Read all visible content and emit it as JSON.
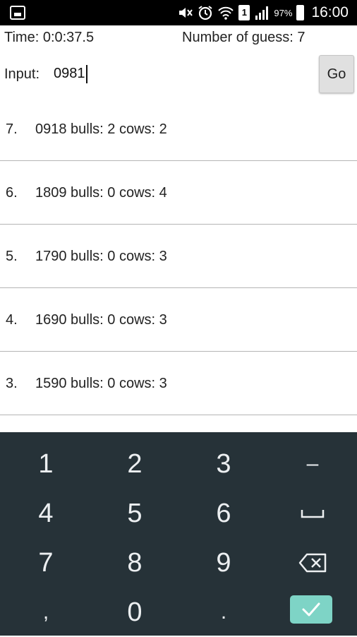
{
  "status_bar": {
    "battery": "97%",
    "sim": "1",
    "time": "16:00",
    "icons": [
      "screenshot-icon",
      "mute-icon",
      "alarm-icon",
      "wifi-icon",
      "sim-icon",
      "signal-icon",
      "battery-icon"
    ]
  },
  "header": {
    "time_label": "Time: 0:0:37.5",
    "guess_count_label": "Number of guess: 7"
  },
  "input": {
    "label": "Input:",
    "value": "0981",
    "go_label": "Go"
  },
  "guesses": [
    {
      "num": "7.",
      "text": "0918 bulls: 2 cows: 2"
    },
    {
      "num": "6.",
      "text": "1809 bulls: 0 cows: 4"
    },
    {
      "num": "5.",
      "text": "1790 bulls: 0 cows: 3"
    },
    {
      "num": "4.",
      "text": "1690 bulls: 0 cows: 3"
    },
    {
      "num": "3.",
      "text": "1590 bulls: 0 cows: 3"
    }
  ],
  "keyboard": {
    "keys": [
      "1",
      "2",
      "3",
      "–",
      "4",
      "5",
      "6",
      "␣",
      "7",
      "8",
      "9",
      ",",
      "0",
      "."
    ],
    "icons": [
      "space-icon",
      "backspace-icon",
      "check-icon"
    ],
    "colors": {
      "background": "#263238",
      "accent": "#7ed4c6"
    }
  }
}
